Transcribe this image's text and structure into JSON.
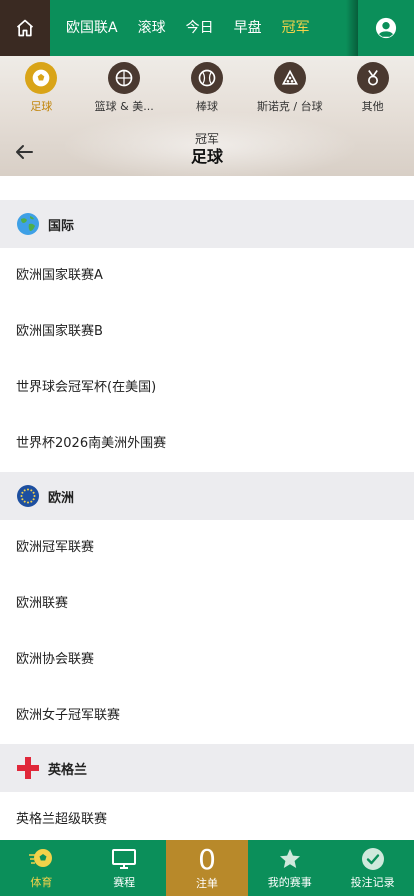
{
  "topnav": {
    "tabs": [
      {
        "label": "欧国联A",
        "active": false
      },
      {
        "label": "滚球",
        "active": false
      },
      {
        "label": "今日",
        "active": false
      },
      {
        "label": "早盘",
        "active": false
      },
      {
        "label": "冠军",
        "active": true
      }
    ]
  },
  "sports": [
    {
      "label": "足球",
      "icon": "soccer-ball-icon",
      "active": true
    },
    {
      "label": "篮球 & 美...",
      "icon": "basketball-football-icon",
      "active": false
    },
    {
      "label": "棒球",
      "icon": "baseball-icon",
      "active": false
    },
    {
      "label": "斯诺克 / 台球",
      "icon": "snooker-icon",
      "active": false
    },
    {
      "label": "其他",
      "icon": "medal-icon",
      "active": false
    }
  ],
  "header": {
    "subtitle": "冠军",
    "title": "足球"
  },
  "sections": [
    {
      "name": "国际",
      "flag": "globe-icon",
      "leagues": [
        "欧洲国家联赛A",
        "欧洲国家联赛B",
        "世界球会冠军杯(在美国)",
        "世界杯2026南美洲外围赛"
      ]
    },
    {
      "name": "欧洲",
      "flag": "eu-flag-icon",
      "leagues": [
        "欧洲冠军联赛",
        "欧洲联赛",
        "欧洲协会联赛",
        "欧洲女子冠军联赛"
      ]
    },
    {
      "name": "英格兰",
      "flag": "england-flag-icon",
      "leagues": [
        "英格兰超级联赛"
      ]
    }
  ],
  "bottombar": {
    "items": [
      {
        "label": "体育",
        "icon": "sports-icon",
        "active": true
      },
      {
        "label": "赛程",
        "icon": "monitor-icon",
        "active": false
      },
      {
        "label": "注单",
        "count": "0",
        "active": false
      },
      {
        "label": "我的赛事",
        "icon": "star-icon",
        "active": false
      },
      {
        "label": "投注记录",
        "icon": "check-circle-icon",
        "active": false
      }
    ]
  },
  "colors": {
    "primary_green": "#0b8f5a",
    "active_gold": "#f2d24a",
    "sport_active": "#d9a418",
    "betslip_gold": "#b8892a"
  }
}
